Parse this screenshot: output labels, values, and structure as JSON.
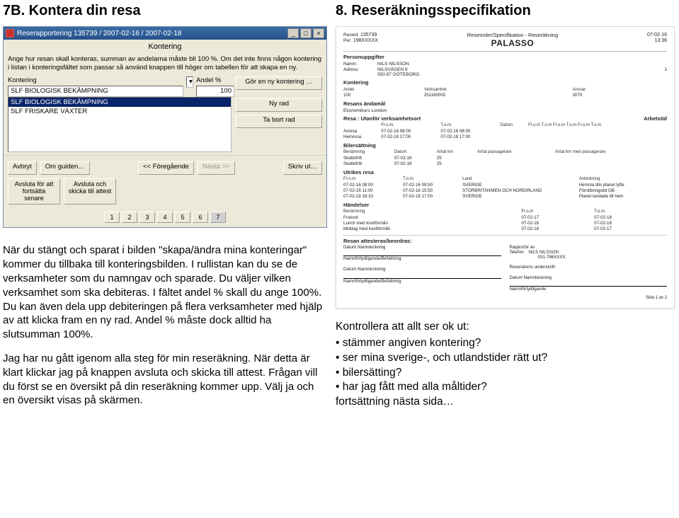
{
  "left": {
    "heading": "7B. Kontera din resa",
    "app": {
      "title": "Reserapportering 135739 / 2007-02-16 / 2007-02-18",
      "section_header": "Kontering",
      "instructions": "Ange hur resan skall konteras, summan av andelarna måste bli 100 %.\nOm det inte finns någon kontering i listan i konteringsfältet som passar så använd knappen till höger om tabellen för att skapa en ny.",
      "kontering_label": "Kontering",
      "kontering_value": "SLF BIOLOGISK BEKÄMPNING",
      "andel_label": "Andel %",
      "andel_value": "100",
      "list_items": [
        "SLF BIOLOGISK BEKÄMPNING",
        "SLF FRISKARE VÄXTER"
      ],
      "btn_new_kontering": "Gör en ny kontering …",
      "btn_new_row": "Ny rad",
      "btn_delete_row": "Ta bort rad",
      "bottom": {
        "avbryt": "Avbryt",
        "om_guiden": "Om guiden…",
        "prev": "<< Föregående",
        "next": "Nästa >>",
        "skriv_ut": "Skriv ut…",
        "finish_later": "Avsluta för att fortsätta senare",
        "finish_send": "Avsluta och skicka till attest"
      },
      "steps": [
        "1",
        "2",
        "3",
        "4",
        "5",
        "6",
        "7"
      ],
      "active_step": 7
    },
    "paragraph1": "När du stängt och sparat i bilden \"skapa/ändra mina konteringar\" kommer du tillbaka till konteringsbilden. I rullistan kan du se de verksamheter som du namngav och sparade. Du väljer vilken verksamhet som ska debiteras. I fältet andel % skall du ange 100%. Du kan även dela upp debiteringen på flera verksamheter med hjälp av att klicka fram en ny rad. Andel % måste dock alltid ha slutsumman 100%.",
    "paragraph2": "Jag har nu gått igenom alla steg för min reseräkning. När detta är klart klickar jag på knappen avsluta och skicka till attest. Frågan vill du först se en översikt på din reseräkning kommer upp. Välj ja och en översikt visas på skärmen."
  },
  "right": {
    "heading": "8. Reseräkningsspecifikation",
    "doc": {
      "reseid_label": "Reseid:",
      "reseid": "135739",
      "per_label": "Per:",
      "per": "198XXXXX",
      "doctitle": "Reseorder/Specifikation - Reseräkning",
      "system": "PALASSO",
      "date": "07-02-16",
      "time": "13:36",
      "person_hdr": "Personuppgifter",
      "person": {
        "namn_l": "Namn:",
        "namn": "NILS NILSSON",
        "adress_l": "Adress:",
        "adress": "NILSVÄGEN 8",
        "postal": "550 67 GÖTEBORG",
        "col_extra": "1"
      },
      "kontering_hdr": "Kontering",
      "kont_h": [
        "Andel",
        "Verksamhet",
        "Ansvar"
      ],
      "kont_r": [
        "100",
        "251160002",
        "3070"
      ],
      "andamal_hdr": "Resans ändamål",
      "andamal": "Ekonomikurs London",
      "resa_hdr_l": "Resa : Utanför verksamhetsort",
      "resa_hdr_r": "Arbetstid",
      "resa_h": [
        "",
        "Fr.o.m.",
        "T.o.m.",
        "Datum",
        "Fr.o.m T.o.m  Fr.o.m T.o.m  Fr.o.m T.o.m"
      ],
      "resa_rows": [
        [
          "Avresa",
          "07-02-16 08:00",
          "07-02-16 08:00",
          "",
          ""
        ],
        [
          "Hemresa",
          "07-02-18 17:00",
          "07-02-18 17:00",
          "",
          ""
        ]
      ],
      "bil_hdr": "Bilersättning",
      "bil_h": [
        "Benämning",
        "Datum",
        "Antal km",
        "Antal passagerare",
        "Antal km med passagerare"
      ],
      "bil_rows": [
        [
          "Skattefritt",
          "07-02-16",
          "25",
          "",
          ""
        ],
        [
          "Skattefritt",
          "07-02-18",
          "25",
          "",
          ""
        ]
      ],
      "utrikes_hdr": "Utrikes resa",
      "utrikes_h": [
        "Fr.o.m.",
        "T.o.m.",
        "Land",
        "Anteckning"
      ],
      "utrikes_rows": [
        [
          "07-02-16 08:00",
          "07-02-16 09:50",
          "SVERIGE",
          "Hemma tills planet lyfte"
        ],
        [
          "07-02-16 11:00",
          "07-02-18 15:50",
          "STORBRITANNIEN OCH NORDIRLAND",
          "Förrättningstid GB"
        ],
        [
          "07-02-18 18:10",
          "07-02-18 17:00",
          "SVERIGE",
          "Planet landade till hem"
        ]
      ],
      "handelser_hdr": "Händelser",
      "hand_h": [
        "Benämning",
        "Fr.o.m",
        "T.o.m."
      ],
      "hand_rows": [
        [
          "Frukost",
          "07-02-17",
          "07-02-18"
        ],
        [
          "Lunch med kostförmån",
          "07-02-16",
          "07-02-18"
        ],
        [
          "Middag med kostförmån",
          "07-02-16",
          "07-02-17"
        ]
      ],
      "attest_hdr": "Resan attesteras/beordras:",
      "sig": {
        "rapportor_l": "Rapportör av",
        "telefon_l": "Telefon:",
        "rapportor_name": "NILS NILSSON",
        "rapportor_tel": "031-786XXXX",
        "datum_namn": "Datum    Namnteckning",
        "namnfort": "Namnförtydligande/Befattning",
        "resenar_undersk": "Resenärens underskrift:",
        "namnfort2": "Namnförtydligande"
      },
      "page_label": "Sida 1 av 2"
    },
    "checklist_lead": "Kontrollera att allt ser ok ut:",
    "checklist": [
      "stämmer angiven kontering?",
      "ser mina sverige-, och utlandstider rätt ut?",
      "bilersätting?",
      "har jag fått med alla måltider?"
    ],
    "cont_text": "fortsättning nästa sida…"
  }
}
